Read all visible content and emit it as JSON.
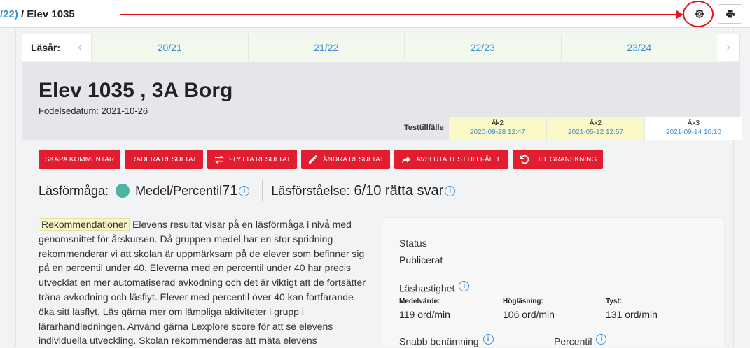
{
  "breadcrumb": {
    "link": "/22)",
    "sep": " / ",
    "current": "Elev 1035"
  },
  "icons": {
    "settings": "gear-icon",
    "print": "print-icon",
    "info": "info-icon"
  },
  "colors": {
    "primary": "#e21d2f",
    "link": "#3d8fd6",
    "level_dot": "#4fb2a3",
    "highlight": "#fbf8c8"
  },
  "school_years": {
    "label": "Läsår:",
    "years": [
      "20/21",
      "21/22",
      "22/23",
      "23/24"
    ]
  },
  "student": {
    "title": "Elev 1035 , 3A Borg",
    "dob": "Födelsedatum: 2021-10-26"
  },
  "test_occasions": {
    "label": "Testtillfälle",
    "items": [
      {
        "grade": "Åk2",
        "date": "2020-09-28 12:47"
      },
      {
        "grade": "Åk2",
        "date": "2021-05-12 12:57"
      },
      {
        "grade": "Åk3",
        "date": "2021-09-14 10:10"
      }
    ]
  },
  "actions": [
    "SKAPA KOMMENTAR",
    "RADERA RESULTAT",
    "FLYTTA RESULTAT",
    "ÄNDRA RESULTAT",
    "AVSLUTA TESTTILLFÄLLE",
    "TILL GRANSKNING"
  ],
  "metrics": {
    "ability_label": "Läsförmåga:",
    "level": "Medel",
    "percentile_label": "/Percentil",
    "percentile": "71",
    "comprehension_label": "Läsförståelse:",
    "comprehension_value": "6/10 rätta svar"
  },
  "recommendation": {
    "tag": "Rekommendationer",
    "text": " Elevens resultat visar på en läsförmåga i nivå med genomsnittet för årskursen. Då gruppen medel har en stor spridning rekommenderar vi att skolan är uppmärksam på de elever som befinner sig på en percentil under 40. Eleverna med en percentil under 40 har precis utvecklat en mer automatiserad avkodning och det är viktigt att de fortsätter träna avkodning och läsflyt. Elever med percentil över 40 kan fortfarande öka sitt läsflyt. Läs gärna mer om lämpliga aktiviteter i grupp i lärarhandledningen. Använd gärna Lexplore score för att se elevens individuella utveckling. Skolan rekommenderas att mäta elevens"
  },
  "panel": {
    "status_label": "Status",
    "status_value": "Publicerat",
    "speed_label": "Läshastighet",
    "speed": [
      {
        "label": "Medelvärde:",
        "value": "119 ord/min"
      },
      {
        "label": "Högläsning:",
        "value": "106 ord/min"
      },
      {
        "label": "Tyst:",
        "value": "131 ord/min"
      }
    ],
    "naming_label": "Snabb benämning",
    "percentile_label": "Percentil"
  }
}
